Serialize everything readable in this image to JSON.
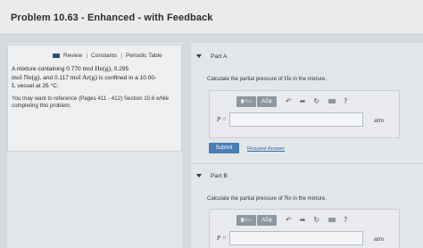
{
  "header": {
    "title": "Problem 10.63 - Enhanced - with Feedback"
  },
  "tools": {
    "review": "Review",
    "constants": "Constants",
    "periodic_table": "Periodic Table"
  },
  "problem": {
    "line1_a": "A mixture containing 0.770 ",
    "line1_b": "mol He(g)",
    "line1_c": ", 0.295",
    "line2_a": "mol Ne(g)",
    "line2_b": ", and 0.117 ",
    "line2_c": "mol Ar(g)",
    "line2_d": " is confined in a 10.00-",
    "line3_a": "L",
    "line3_b": " vessel at 25 °C.",
    "reference": "You may want to reference (Pages 411 - 412) Section 10.6 while completing this problem."
  },
  "part_a": {
    "label": "Part A",
    "question_a": "Calculate the partial pressure of ",
    "question_b": "He",
    "question_c": " in the mixture.",
    "var": "P =",
    "unit": "atm",
    "input_value": "",
    "submit": "Submit",
    "request": "Request Answer"
  },
  "part_b": {
    "label": "Part B",
    "question_a": "Calculate the partial pressure of ",
    "question_b": "Ne",
    "question_c": " in the mixture.",
    "var": "P =",
    "unit": "atm",
    "input_value": ""
  },
  "toolbar": {
    "templates": "▮√▭",
    "symbols": "ΑΣφ",
    "undo": "↶",
    "redo": "➦",
    "reset": "↻",
    "help": "?"
  },
  "colors": {
    "submit_bg": "#4a7eb5",
    "link": "#3a6aa2"
  }
}
